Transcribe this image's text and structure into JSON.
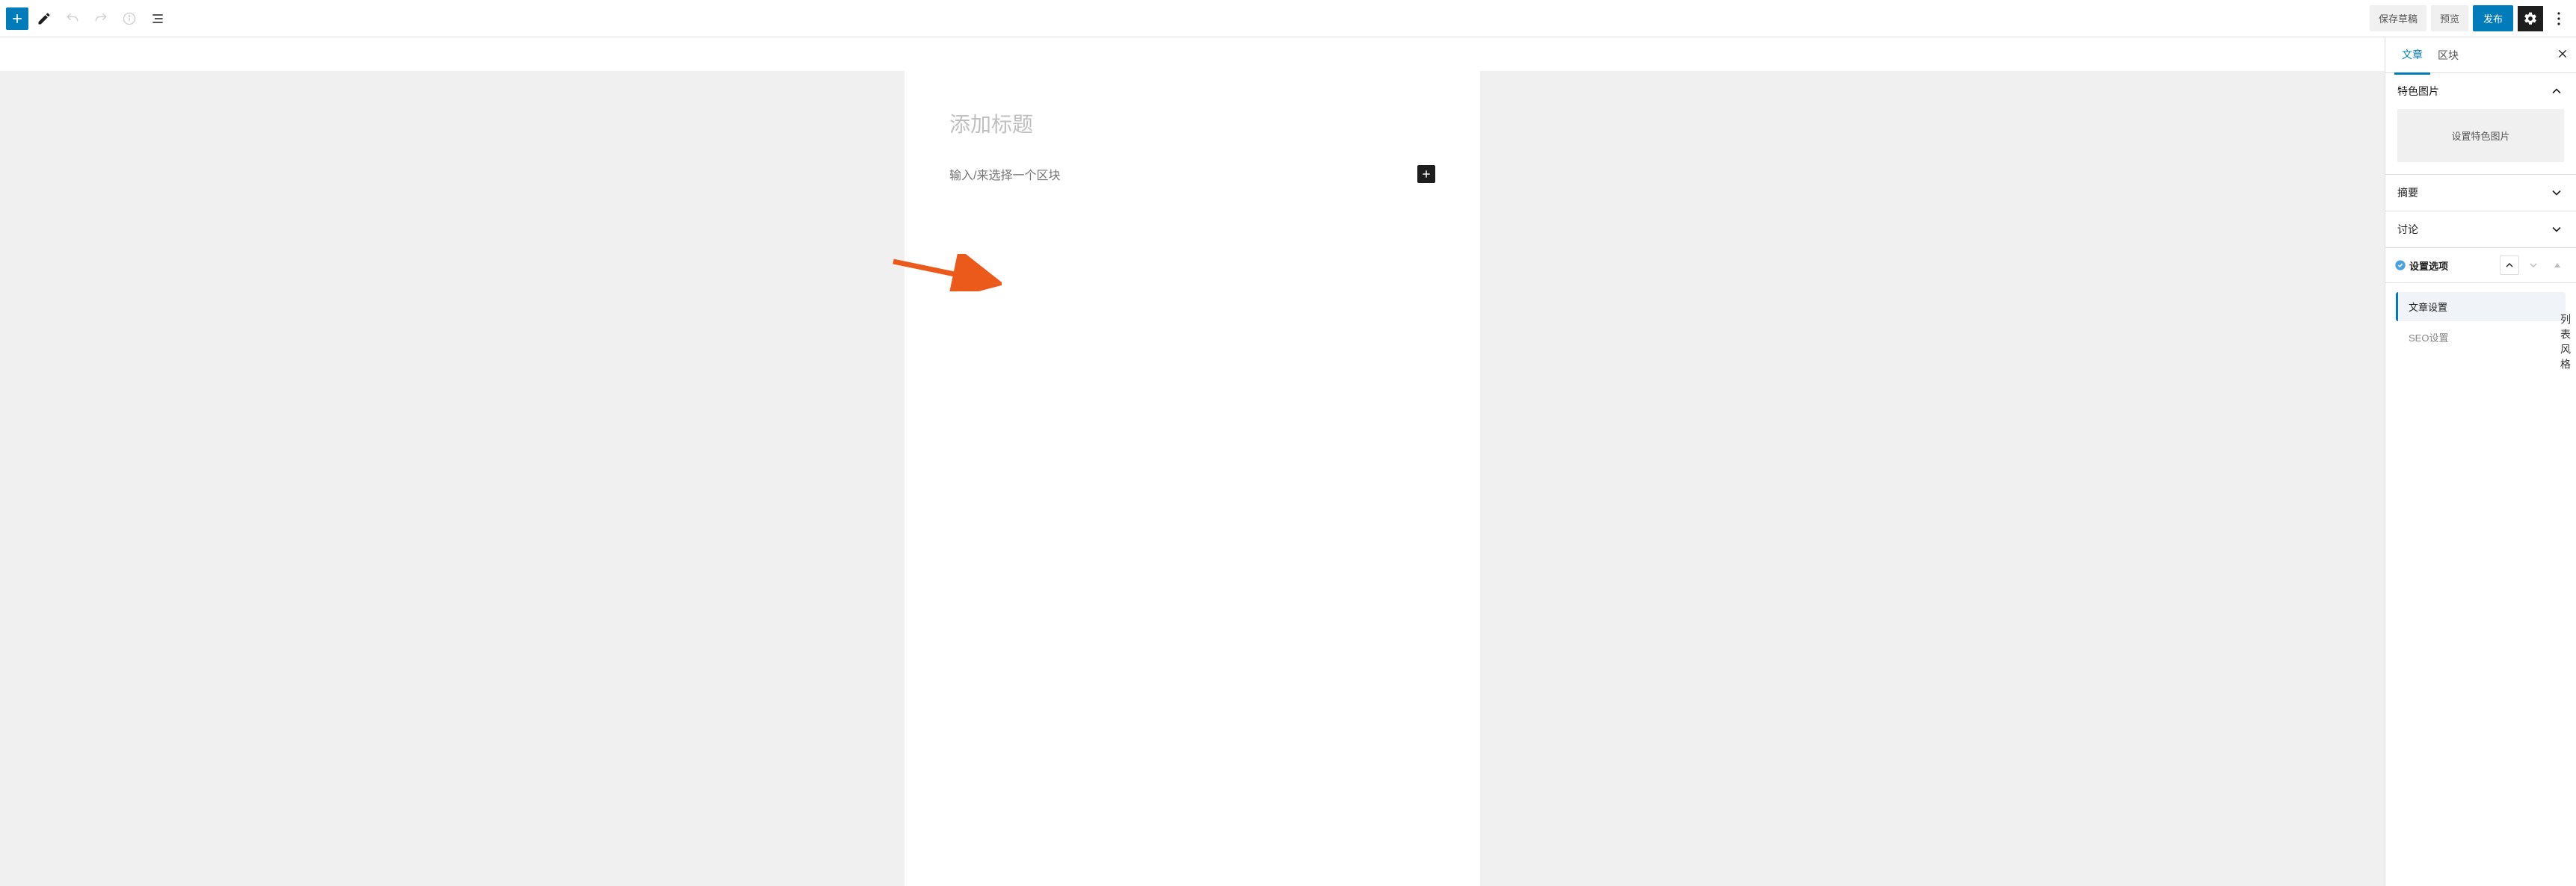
{
  "toolbar": {
    "save_draft": "保存草稿",
    "preview": "预览",
    "publish": "发布"
  },
  "editor": {
    "title_placeholder": "添加标题",
    "block_prompt": "输入/来选择一个区块"
  },
  "sidebar": {
    "tabs": {
      "post": "文章",
      "block": "区块"
    },
    "featured_image": {
      "label": "特色图片",
      "button": "设置特色图片"
    },
    "excerpt": {
      "label": "摘要"
    },
    "discussion": {
      "label": "讨论"
    },
    "settings_options": {
      "label": "设置选项",
      "tabs": {
        "post_settings": "文章设置",
        "seo_settings": "SEO设置"
      }
    }
  },
  "right_label": "列表风格"
}
